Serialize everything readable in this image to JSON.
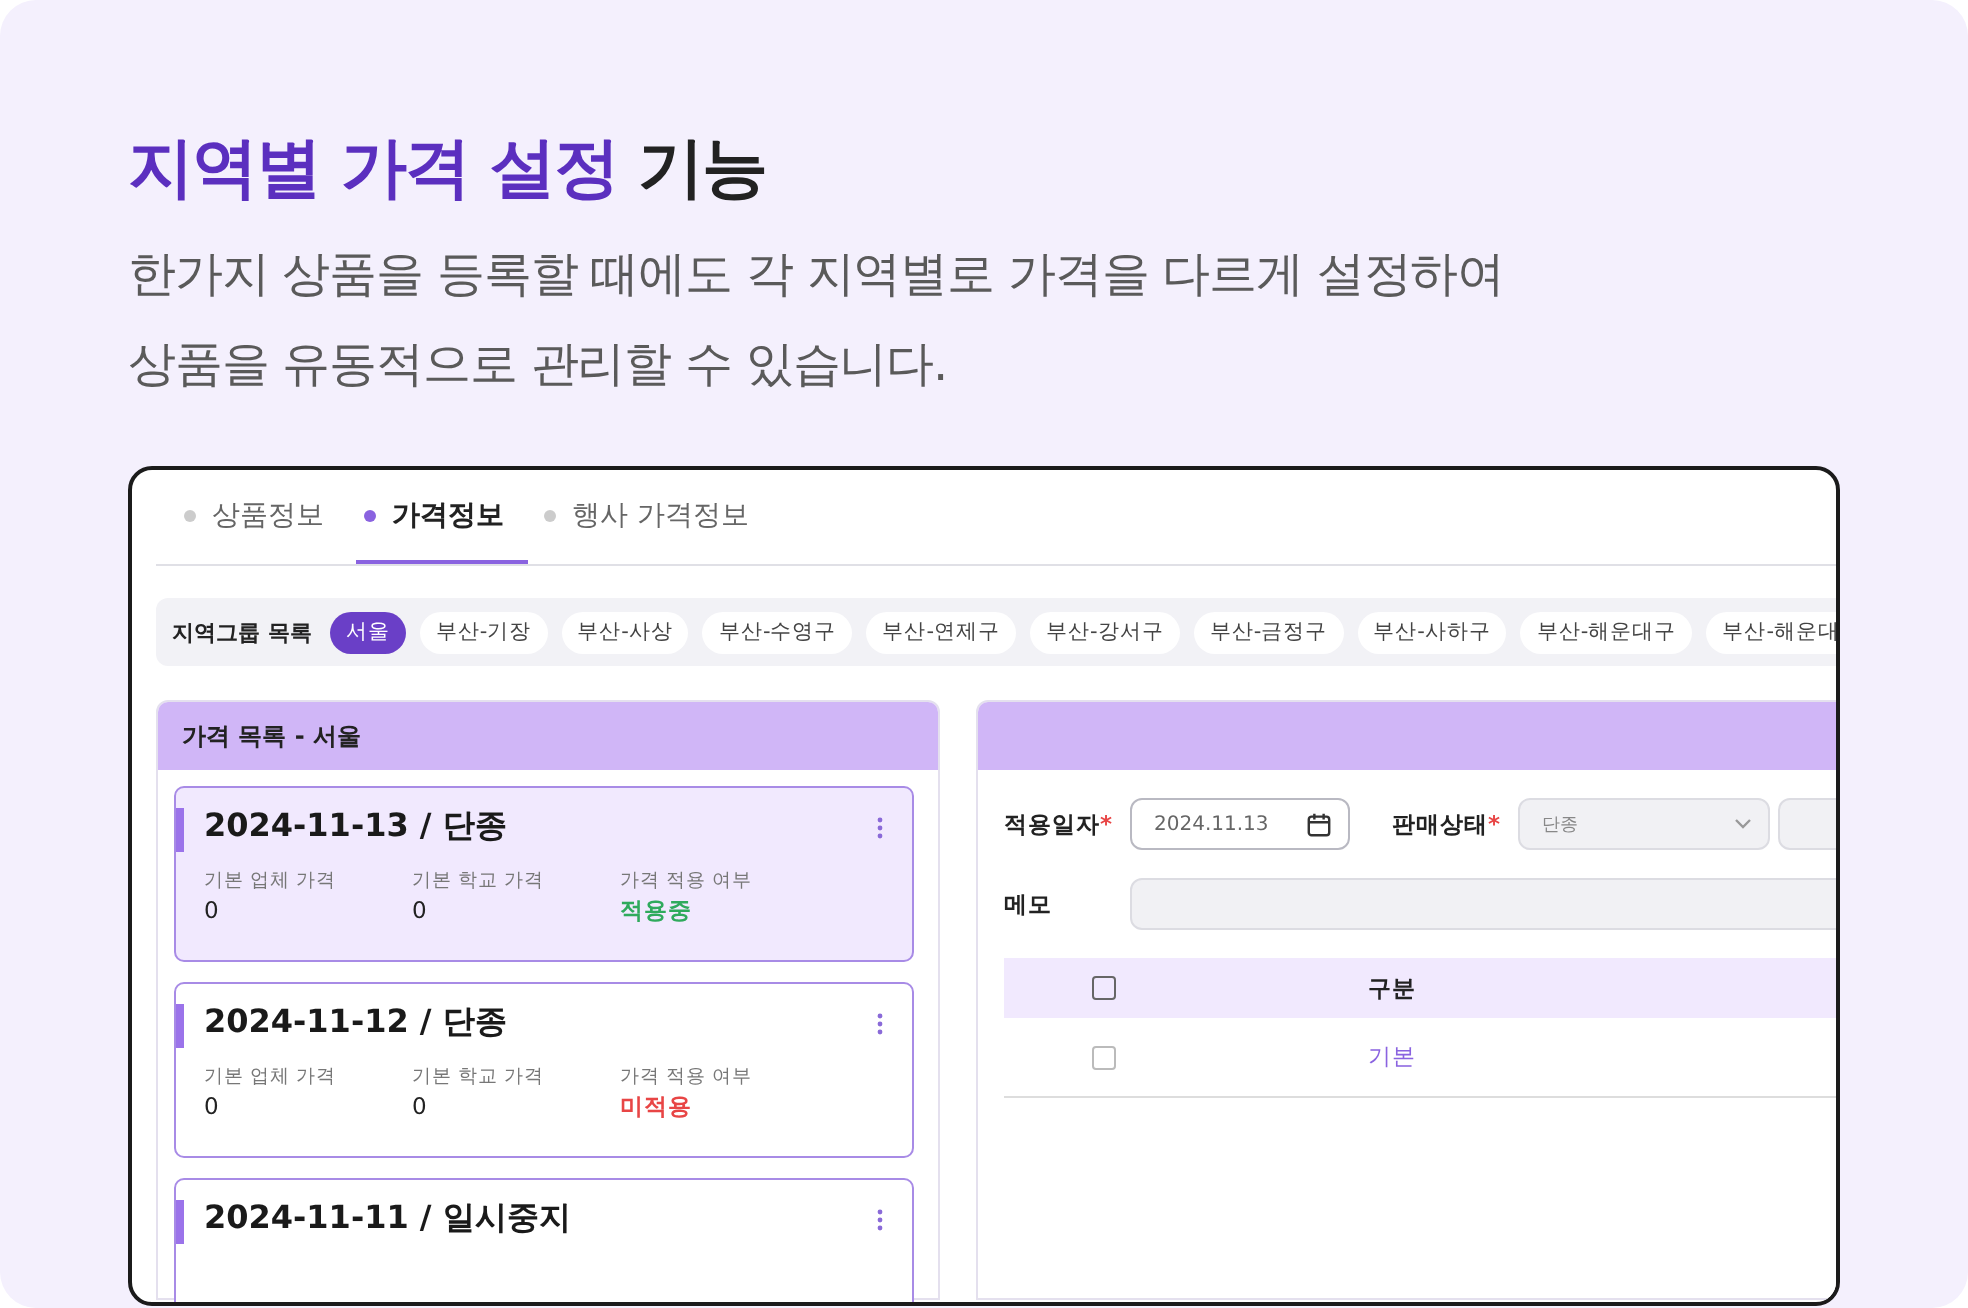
{
  "heading": {
    "highlight": "지역별 가격 설정",
    "rest": "기능"
  },
  "description": [
    "한가지 상품을 등록할 때에도 각 지역별로 가격을 다르게 설정하여",
    "상품을 유동적으로 관리할 수 있습니다."
  ],
  "tabs": [
    {
      "label": "상품정보",
      "selected": false
    },
    {
      "label": "가격정보",
      "selected": true
    },
    {
      "label": "행사 가격정보",
      "selected": false
    }
  ],
  "region_groups": {
    "label": "지역그룹 목록",
    "chips": [
      {
        "label": "서울",
        "selected": true
      },
      {
        "label": "부산-기장",
        "selected": false
      },
      {
        "label": "부산-사상",
        "selected": false
      },
      {
        "label": "부산-수영구",
        "selected": false
      },
      {
        "label": "부산-연제구",
        "selected": false
      },
      {
        "label": "부산-강서구",
        "selected": false
      },
      {
        "label": "부산-금정구",
        "selected": false
      },
      {
        "label": "부산-사하구",
        "selected": false
      },
      {
        "label": "부산-해운대구",
        "selected": false
      },
      {
        "label": "부산-해운대",
        "selected": false
      }
    ]
  },
  "price_list": {
    "title": "가격 목록 - 서울",
    "cards": [
      {
        "title": "2024-11-13 / 단종",
        "selected": true,
        "fields": [
          {
            "label": "기본 업체 가격",
            "value": "0"
          },
          {
            "label": "기본 학교 가격",
            "value": "0"
          },
          {
            "label": "가격 적용 여부",
            "value": "적용중",
            "kind": "applied"
          }
        ]
      },
      {
        "title": "2024-11-12 / 단종",
        "selected": false,
        "fields": [
          {
            "label": "기본 업체 가격",
            "value": "0"
          },
          {
            "label": "기본 학교 가격",
            "value": "0"
          },
          {
            "label": "가격 적용 여부",
            "value": "미적용",
            "kind": "not_applied"
          }
        ]
      },
      {
        "title": "2024-11-11 / 일시중지",
        "selected": false
      }
    ]
  },
  "detail": {
    "date": {
      "label": "적용일자",
      "required_mark": "*",
      "value": "2024.11.13"
    },
    "sale_status": {
      "label": "판매상태",
      "required_mark": "*",
      "value": "단종",
      "disabled": true
    },
    "memo": {
      "label": "메모",
      "disabled": true
    },
    "table": {
      "columns": [
        "구분"
      ],
      "rows": [
        {
          "cell": "기본",
          "checked": false
        }
      ],
      "header_checked": false
    }
  }
}
